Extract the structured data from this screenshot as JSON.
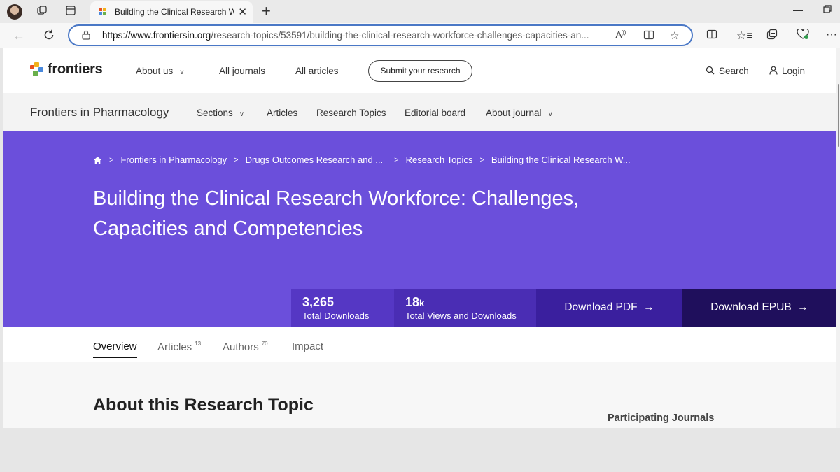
{
  "browser": {
    "tab_title": "Building the Clinical Research Wo",
    "close_glyph": "✕",
    "new_tab_glyph": "+",
    "url_domain": "https://www.frontiersin.org",
    "url_path": "/research-topics/53591/building-the-clinical-research-workforce-challenges-capacities-an..."
  },
  "site": {
    "logo_text": "frontiers",
    "nav": {
      "about": "About us",
      "journals": "All journals",
      "articles": "All articles",
      "submit": "Submit your research",
      "search": "Search",
      "login": "Login"
    }
  },
  "journal": {
    "name": "Frontiers in Pharmacology",
    "nav": {
      "sections": "Sections",
      "articles": "Articles",
      "research_topics": "Research Topics",
      "editorial_board": "Editorial board",
      "about_journal": "About journal"
    }
  },
  "hero": {
    "breadcrumb": [
      "Frontiers in Pharmacology",
      "Drugs Outcomes Research and ...",
      "Research Topics",
      "Building the Clinical Research W..."
    ],
    "title": "Building the Clinical Research Workforce: Challenges, Capacities and Competencies",
    "downloads_value": "3,265",
    "downloads_label": "Total Downloads",
    "views_value": "18",
    "views_unit": "k",
    "views_label": "Total Views and Downloads",
    "download_pdf": "Download PDF",
    "download_epub": "Download EPUB",
    "arrow": "→"
  },
  "page_tabs": [
    {
      "label": "Overview",
      "count": ""
    },
    {
      "label": "Articles",
      "count": "13"
    },
    {
      "label": "Authors",
      "count": "70"
    },
    {
      "label": "Impact",
      "count": ""
    }
  ],
  "content": {
    "about_title": "About this Research Topic",
    "participating_journals": "Participating Journals"
  },
  "colors": {
    "hero_bg": "#6b4fdb",
    "pdf_btn": "#3a1f9e",
    "epub_btn": "#1f0f5c",
    "address_focus": "#4a78c6"
  }
}
